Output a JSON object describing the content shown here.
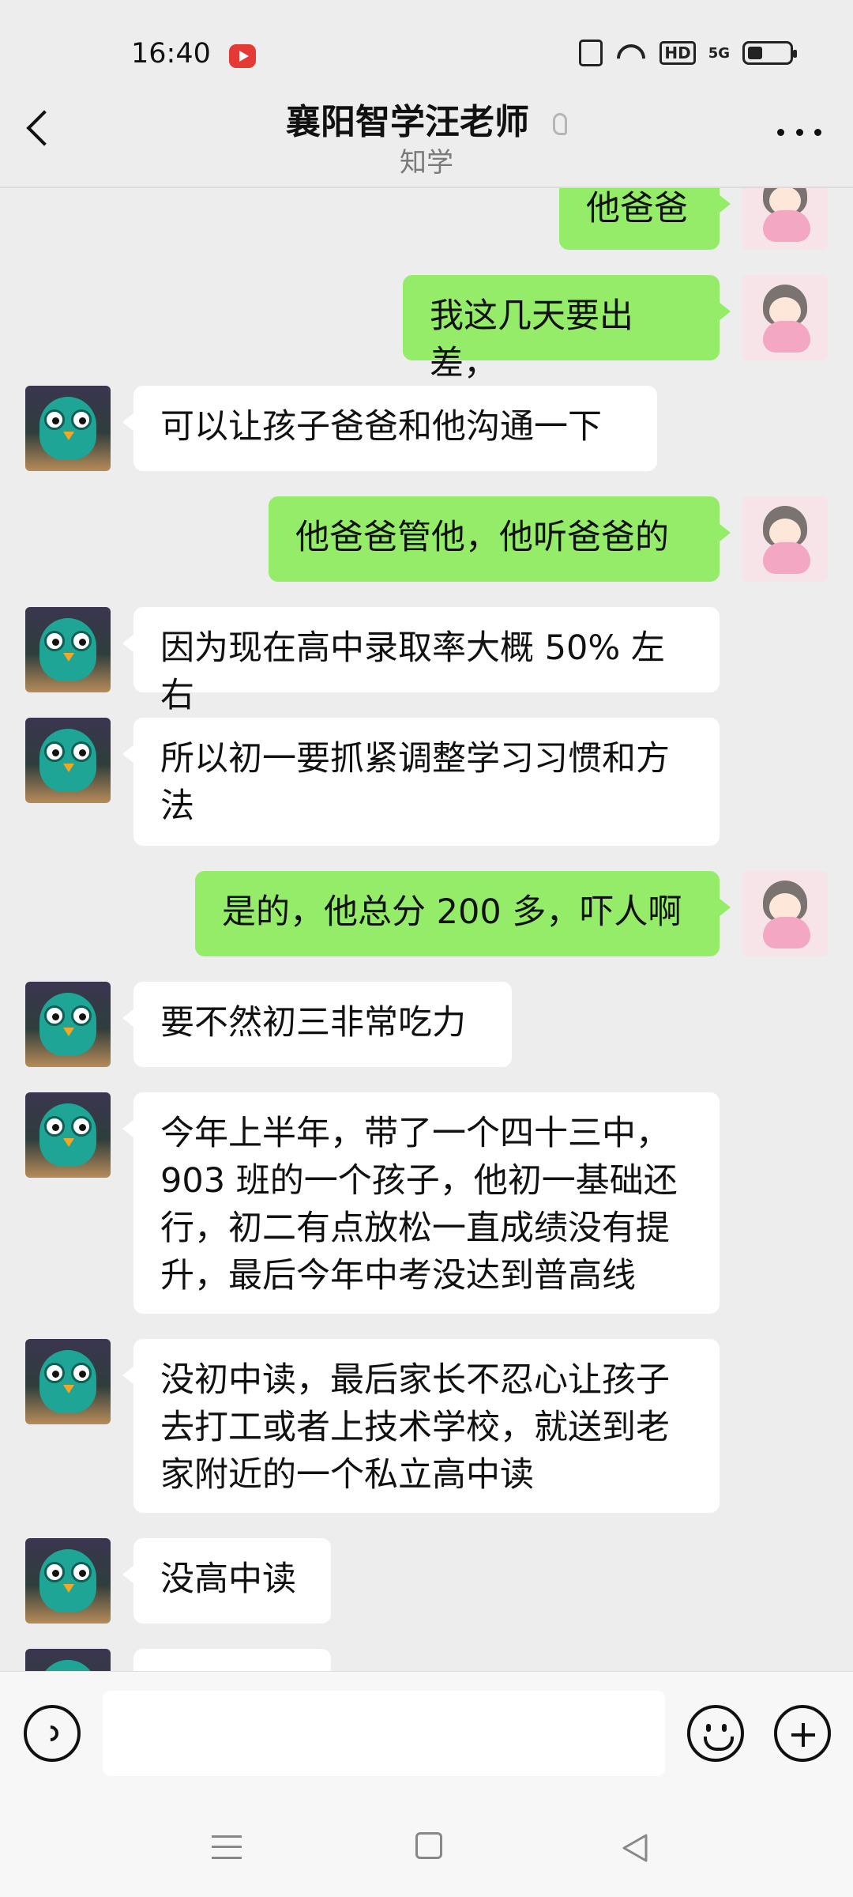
{
  "status_bar": {
    "time": "16:40",
    "hd": "HD",
    "signal": "5G"
  },
  "header": {
    "title": "襄阳智学汪老师",
    "subtitle": "知学"
  },
  "messages": [
    {
      "side": "right",
      "avatar": "girl-avatar",
      "text": "他爸爸"
    },
    {
      "side": "right",
      "avatar": "girl-avatar",
      "text": "我这几天要出差，"
    },
    {
      "side": "left",
      "avatar": "owl-avatar",
      "text": "可以让孩子爸爸和他沟通一下"
    },
    {
      "side": "right",
      "avatar": "girl-avatar",
      "text": "他爸爸管他，他听爸爸的"
    },
    {
      "side": "left",
      "avatar": "owl-avatar",
      "text": "因为现在高中录取率大概 50% 左右"
    },
    {
      "side": "left",
      "avatar": "owl-avatar",
      "text": "所以初一要抓紧调整学习习惯和方法"
    },
    {
      "side": "right",
      "avatar": "girl-avatar",
      "text": "是的，他总分 200 多，吓人啊"
    },
    {
      "side": "left",
      "avatar": "owl-avatar",
      "text": "要不然初三非常吃力"
    },
    {
      "side": "left",
      "avatar": "owl-avatar",
      "text": "今年上半年，带了一个四十三中，903 班的一个孩子，他初一基础还行，初二有点放松一直成绩没有提升，最后今年中考没达到普高线"
    },
    {
      "side": "left",
      "avatar": "owl-avatar",
      "text": "没初中读，最后家长不忍心让孩子去打工或者上技术学校，就送到老家附近的一个私立高中读"
    },
    {
      "side": "left",
      "avatar": "owl-avatar",
      "text": "没高中读"
    },
    {
      "side": "left",
      "avatar": "owl-avatar",
      "text": ""
    }
  ],
  "input": {
    "value": "",
    "placeholder": ""
  },
  "colors": {
    "background": "#ededed",
    "sent_bubble": "#95ec69",
    "received_bubble": "#ffffff"
  }
}
